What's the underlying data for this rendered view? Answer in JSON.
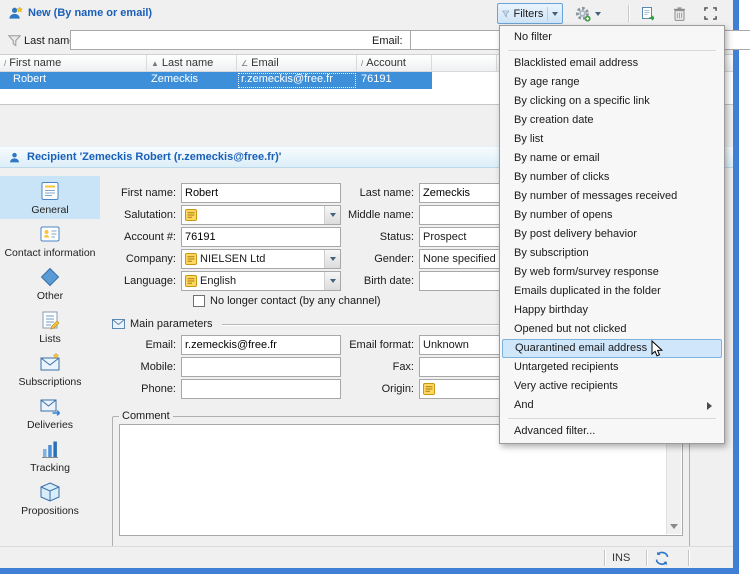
{
  "window": {
    "title": "New (By name or email)",
    "status_ins": "INS"
  },
  "toolbar": {
    "filters_label": "Filters"
  },
  "filter_row": {
    "last_name_label": "Last name:",
    "last_name_value": "",
    "email_label": "Email:",
    "email_value": ""
  },
  "table": {
    "columns": [
      {
        "label": "First name",
        "indicator": "/"
      },
      {
        "label": "Last name",
        "indicator": "▲"
      },
      {
        "label": "Email",
        "indicator": "∠"
      },
      {
        "label": "Account",
        "indicator": "/"
      }
    ],
    "row": {
      "first_name": "Robert",
      "last_name": "Zemeckis",
      "email": "r.zemeckis@free.fr",
      "account": "76191"
    }
  },
  "detail": {
    "header": "Recipient 'Zemeckis Robert (r.zemeckis@free.fr)'"
  },
  "sidebar": {
    "items": [
      {
        "label": "General"
      },
      {
        "label": "Contact information"
      },
      {
        "label": "Other"
      },
      {
        "label": "Lists"
      },
      {
        "label": "Subscriptions"
      },
      {
        "label": "Deliveries"
      },
      {
        "label": "Tracking"
      },
      {
        "label": "Propositions"
      }
    ]
  },
  "form": {
    "first_name": {
      "label": "First name:",
      "value": "Robert"
    },
    "last_name": {
      "label": "Last name:",
      "value": "Zemeckis"
    },
    "salutation": {
      "label": "Salutation:",
      "value": ""
    },
    "middle_name": {
      "label": "Middle name:",
      "value": ""
    },
    "account": {
      "label": "Account #:",
      "value": "76191"
    },
    "status": {
      "label": "Status:",
      "value": "Prospect"
    },
    "company": {
      "label": "Company:",
      "value": "NIELSEN Ltd"
    },
    "gender": {
      "label": "Gender:",
      "value": "None specified"
    },
    "language": {
      "label": "Language:",
      "value": "English"
    },
    "birth_date": {
      "label": "Birth date:",
      "value": ""
    },
    "no_longer_contact_label": "No longer contact (by any channel)",
    "main_parameters_label": "Main parameters",
    "email": {
      "label": "Email:",
      "value": "r.zemeckis@free.fr"
    },
    "email_format": {
      "label": "Email format:",
      "value": "Unknown"
    },
    "mobile": {
      "label": "Mobile:",
      "value": ""
    },
    "fax": {
      "label": "Fax:",
      "value": ""
    },
    "phone": {
      "label": "Phone:",
      "value": ""
    },
    "origin": {
      "label": "Origin:",
      "value": ""
    },
    "comment_legend": "Comment",
    "comment_value": ""
  },
  "menu": {
    "items": [
      {
        "label": "No filter"
      },
      {
        "label": "Blacklisted email address"
      },
      {
        "label": "By age range"
      },
      {
        "label": "By clicking on a specific link"
      },
      {
        "label": "By creation date"
      },
      {
        "label": "By list"
      },
      {
        "label": "By name or email"
      },
      {
        "label": "By number of clicks"
      },
      {
        "label": "By number of messages received"
      },
      {
        "label": "By number of opens"
      },
      {
        "label": "By post delivery behavior"
      },
      {
        "label": "By subscription"
      },
      {
        "label": "By web form/survey response"
      },
      {
        "label": "Emails duplicated in the folder"
      },
      {
        "label": "Happy birthday"
      },
      {
        "label": "Opened but not clicked"
      },
      {
        "label": "Quarantined email address"
      },
      {
        "label": "Untargeted recipients"
      },
      {
        "label": "Very active recipients"
      },
      {
        "label": "And"
      },
      {
        "label": "Advanced filter..."
      }
    ]
  },
  "colors": {
    "accent": "#3f7fd6",
    "row_selection": "#3d8fd9",
    "menu_highlight": "#cfe6fb",
    "combo_icon_yellow": "#ffd863"
  }
}
